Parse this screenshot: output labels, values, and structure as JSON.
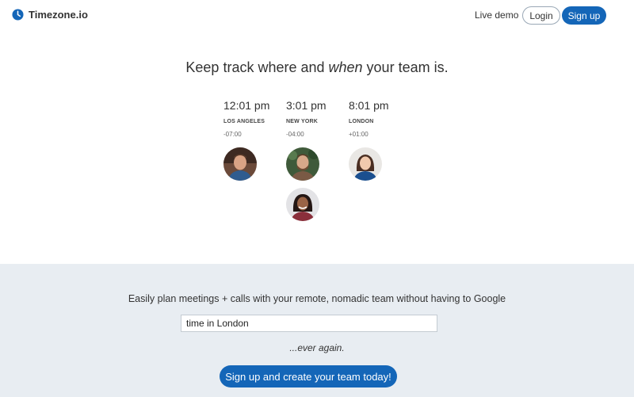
{
  "nav": {
    "brand": "Timezone.io",
    "logo_icon": "clock-icon",
    "live_demo": "Live demo",
    "login": "Login",
    "signup": "Sign up"
  },
  "hero": {
    "title_before": "Keep track where and ",
    "title_emphasis": "when",
    "title_after": " your team is."
  },
  "zones": [
    {
      "time": "12:01 pm",
      "city": "LOS ANGELES",
      "offset": "-07:00"
    },
    {
      "time": "3:01 pm",
      "city": "NEW YORK",
      "offset": "-04:00"
    },
    {
      "time": "8:01 pm",
      "city": "LONDON",
      "offset": "+01:00"
    }
  ],
  "promo": {
    "tagline": "Easily plan meetings + calls with your remote, nomadic team without having to Google",
    "search_value": "time in London",
    "ever_again": "...ever again.",
    "cta": "Sign up and create your team today!"
  },
  "colors": {
    "accent": "#1466b8",
    "band": "#e8edf2"
  }
}
